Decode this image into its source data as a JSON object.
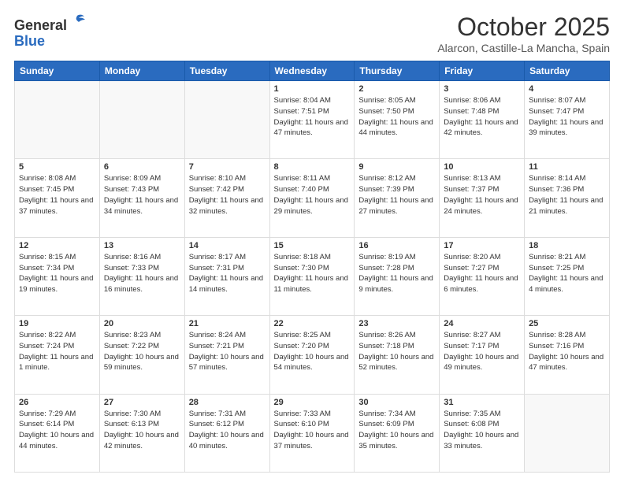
{
  "header": {
    "logo_general": "General",
    "logo_blue": "Blue",
    "month_title": "October 2025",
    "location": "Alarcon, Castille-La Mancha, Spain"
  },
  "days_of_week": [
    "Sunday",
    "Monday",
    "Tuesday",
    "Wednesday",
    "Thursday",
    "Friday",
    "Saturday"
  ],
  "weeks": [
    [
      {
        "day": "",
        "info": ""
      },
      {
        "day": "",
        "info": ""
      },
      {
        "day": "",
        "info": ""
      },
      {
        "day": "1",
        "info": "Sunrise: 8:04 AM\nSunset: 7:51 PM\nDaylight: 11 hours and 47 minutes."
      },
      {
        "day": "2",
        "info": "Sunrise: 8:05 AM\nSunset: 7:50 PM\nDaylight: 11 hours and 44 minutes."
      },
      {
        "day": "3",
        "info": "Sunrise: 8:06 AM\nSunset: 7:48 PM\nDaylight: 11 hours and 42 minutes."
      },
      {
        "day": "4",
        "info": "Sunrise: 8:07 AM\nSunset: 7:47 PM\nDaylight: 11 hours and 39 minutes."
      }
    ],
    [
      {
        "day": "5",
        "info": "Sunrise: 8:08 AM\nSunset: 7:45 PM\nDaylight: 11 hours and 37 minutes."
      },
      {
        "day": "6",
        "info": "Sunrise: 8:09 AM\nSunset: 7:43 PM\nDaylight: 11 hours and 34 minutes."
      },
      {
        "day": "7",
        "info": "Sunrise: 8:10 AM\nSunset: 7:42 PM\nDaylight: 11 hours and 32 minutes."
      },
      {
        "day": "8",
        "info": "Sunrise: 8:11 AM\nSunset: 7:40 PM\nDaylight: 11 hours and 29 minutes."
      },
      {
        "day": "9",
        "info": "Sunrise: 8:12 AM\nSunset: 7:39 PM\nDaylight: 11 hours and 27 minutes."
      },
      {
        "day": "10",
        "info": "Sunrise: 8:13 AM\nSunset: 7:37 PM\nDaylight: 11 hours and 24 minutes."
      },
      {
        "day": "11",
        "info": "Sunrise: 8:14 AM\nSunset: 7:36 PM\nDaylight: 11 hours and 21 minutes."
      }
    ],
    [
      {
        "day": "12",
        "info": "Sunrise: 8:15 AM\nSunset: 7:34 PM\nDaylight: 11 hours and 19 minutes."
      },
      {
        "day": "13",
        "info": "Sunrise: 8:16 AM\nSunset: 7:33 PM\nDaylight: 11 hours and 16 minutes."
      },
      {
        "day": "14",
        "info": "Sunrise: 8:17 AM\nSunset: 7:31 PM\nDaylight: 11 hours and 14 minutes."
      },
      {
        "day": "15",
        "info": "Sunrise: 8:18 AM\nSunset: 7:30 PM\nDaylight: 11 hours and 11 minutes."
      },
      {
        "day": "16",
        "info": "Sunrise: 8:19 AM\nSunset: 7:28 PM\nDaylight: 11 hours and 9 minutes."
      },
      {
        "day": "17",
        "info": "Sunrise: 8:20 AM\nSunset: 7:27 PM\nDaylight: 11 hours and 6 minutes."
      },
      {
        "day": "18",
        "info": "Sunrise: 8:21 AM\nSunset: 7:25 PM\nDaylight: 11 hours and 4 minutes."
      }
    ],
    [
      {
        "day": "19",
        "info": "Sunrise: 8:22 AM\nSunset: 7:24 PM\nDaylight: 11 hours and 1 minute."
      },
      {
        "day": "20",
        "info": "Sunrise: 8:23 AM\nSunset: 7:22 PM\nDaylight: 10 hours and 59 minutes."
      },
      {
        "day": "21",
        "info": "Sunrise: 8:24 AM\nSunset: 7:21 PM\nDaylight: 10 hours and 57 minutes."
      },
      {
        "day": "22",
        "info": "Sunrise: 8:25 AM\nSunset: 7:20 PM\nDaylight: 10 hours and 54 minutes."
      },
      {
        "day": "23",
        "info": "Sunrise: 8:26 AM\nSunset: 7:18 PM\nDaylight: 10 hours and 52 minutes."
      },
      {
        "day": "24",
        "info": "Sunrise: 8:27 AM\nSunset: 7:17 PM\nDaylight: 10 hours and 49 minutes."
      },
      {
        "day": "25",
        "info": "Sunrise: 8:28 AM\nSunset: 7:16 PM\nDaylight: 10 hours and 47 minutes."
      }
    ],
    [
      {
        "day": "26",
        "info": "Sunrise: 7:29 AM\nSunset: 6:14 PM\nDaylight: 10 hours and 44 minutes."
      },
      {
        "day": "27",
        "info": "Sunrise: 7:30 AM\nSunset: 6:13 PM\nDaylight: 10 hours and 42 minutes."
      },
      {
        "day": "28",
        "info": "Sunrise: 7:31 AM\nSunset: 6:12 PM\nDaylight: 10 hours and 40 minutes."
      },
      {
        "day": "29",
        "info": "Sunrise: 7:33 AM\nSunset: 6:10 PM\nDaylight: 10 hours and 37 minutes."
      },
      {
        "day": "30",
        "info": "Sunrise: 7:34 AM\nSunset: 6:09 PM\nDaylight: 10 hours and 35 minutes."
      },
      {
        "day": "31",
        "info": "Sunrise: 7:35 AM\nSunset: 6:08 PM\nDaylight: 10 hours and 33 minutes."
      },
      {
        "day": "",
        "info": ""
      }
    ]
  ]
}
